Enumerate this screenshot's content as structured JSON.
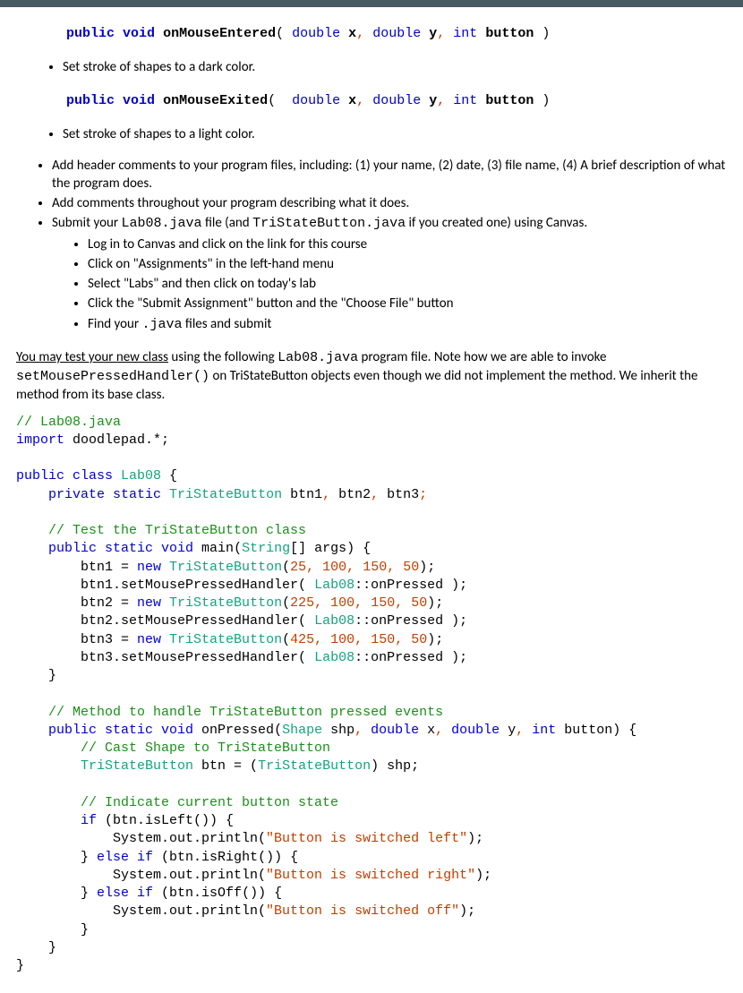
{
  "sig1": {
    "kw1": "public",
    "kw2": "void",
    "method": "onMouseEntered",
    "open": "(",
    "t1": "double",
    "p1": "x",
    "c1": ",",
    "t2": "double",
    "p2": "y",
    "c2": ",",
    "t3": "int",
    "p3": "button",
    "close": ")"
  },
  "sig1_note": "Set stroke of shapes to a dark color.",
  "sig2": {
    "kw1": "public",
    "kw2": "void",
    "method": "onMouseExited",
    "open": "(",
    "t1": "double",
    "p1": "x",
    "c1": ",",
    "t2": "double",
    "p2": "y",
    "c2": ",",
    "t3": "int",
    "p3": "button",
    "close": ")"
  },
  "sig2_note": "Set stroke of shapes to a light color.",
  "bullets": {
    "b1": "Add header comments to your program files, including: (1) your name, (2) date, (3) file name, (4) A brief description of what the program does.",
    "b2": "Add comments throughout your program describing what it does.",
    "b3_pre": "Submit your ",
    "b3_code1": "Lab08.java",
    "b3_mid": " file (and ",
    "b3_code2": "TriStateButton.java",
    "b3_post": " if you created one) using Canvas.",
    "sub1": "Log in to Canvas and click on the link for this course",
    "sub2": "Click on \"Assignments\" in the left-hand menu",
    "sub3": "Select \"Labs\" and then click on today's lab",
    "sub4": "Click the \"Submit Assignment\" button and the \"Choose File\" button",
    "sub5_pre": "Find your ",
    "sub5_code": ".java",
    "sub5_post": " files and submit"
  },
  "para": {
    "u": "You may test your new class",
    "t1": " using the following ",
    "c1": "Lab08.java",
    "t2": " program file. Note how we are able to invoke ",
    "c2": "setMousePressedHandler()",
    "t3": " on TriStateButton objects even though we did not implement the method. We inherit the method from its base class."
  },
  "code": {
    "l01a": "// Lab08.java",
    "l02a": "import",
    "l02b": " doodlepad.*;",
    "l04a": "public",
    "l04b": " class",
    "l04c": " Lab08",
    "l04d": " {",
    "l05a": "    private",
    "l05b": " static",
    "l05c": " TriStateButton",
    "l05d": " btn1",
    "l05p1": ",",
    "l05e": " btn2",
    "l05p2": ",",
    "l05f": " btn3",
    "l05p3": ";",
    "l07a": "    // Test the TriStateButton class",
    "l08a": "    public",
    "l08b": " static",
    "l08c": " void",
    "l08d": " main",
    "l08e": "(",
    "l08f": "String",
    "l08g": "[] args) {",
    "l09a": "        btn1 = ",
    "l09b": "new",
    "l09c": " TriStateButton",
    "l09d": "(",
    "l09n1": "25",
    "l09c1": ",",
    "l09s1": " ",
    "l09n2": "100",
    "l09c2": ",",
    "l09s2": " ",
    "l09n3": "150",
    "l09c3": ",",
    "l09s3": " ",
    "l09n4": "50",
    "l09e": ");",
    "l10a": "        btn1.setMousePressedHandler( ",
    "l10b": "Lab08",
    "l10c": "::onPressed );",
    "l11a": "        btn2 = ",
    "l11b": "new",
    "l11c": " TriStateButton",
    "l11d": "(",
    "l11n1": "225",
    "l11c1": ",",
    "l11s1": " ",
    "l11n2": "100",
    "l11c2": ",",
    "l11s2": " ",
    "l11n3": "150",
    "l11c3": ",",
    "l11s3": " ",
    "l11n4": "50",
    "l11e": ");",
    "l12a": "        btn2.setMousePressedHandler( ",
    "l12b": "Lab08",
    "l12c": "::onPressed );",
    "l13a": "        btn3 = ",
    "l13b": "new",
    "l13c": " TriStateButton",
    "l13d": "(",
    "l13n1": "425",
    "l13c1": ",",
    "l13s1": " ",
    "l13n2": "100",
    "l13c2": ",",
    "l13s2": " ",
    "l13n3": "150",
    "l13c3": ",",
    "l13s3": " ",
    "l13n4": "50",
    "l13e": ");",
    "l14a": "        btn3.setMousePressedHandler( ",
    "l14b": "Lab08",
    "l14c": "::onPressed );",
    "l15a": "    }",
    "l17a": "    // Method to handle TriStateButton pressed events",
    "l18a": "    public",
    "l18b": " static",
    "l18c": " void",
    "l18d": " onPressed",
    "l18e": "(",
    "l18f": "Shape",
    "l18g": " shp",
    "l18p1": ",",
    "l18h": " double",
    "l18i": " x",
    "l18p2": ",",
    "l18j": " double",
    "l18k": " y",
    "l18p3": ",",
    "l18l": " int",
    "l18m": " button) {",
    "l19a": "        // Cast Shape to TriStateButton",
    "l20a": "        TriStateButton",
    "l20b": " btn = (",
    "l20c": "TriStateButton",
    "l20d": ") shp;",
    "l22a": "        // Indicate current button state",
    "l23a": "        if",
    "l23b": " (btn.isLeft()) {",
    "l24a": "            System.out.println(",
    "l24b": "\"Button is switched left\"",
    "l24c": ");",
    "l25a": "        } ",
    "l25b": "else",
    "l25c": " if",
    "l25d": " (btn.isRight()) {",
    "l26a": "            System.out.println(",
    "l26b": "\"Button is switched right\"",
    "l26c": ");",
    "l27a": "        } ",
    "l27b": "else",
    "l27c": " if",
    "l27d": " (btn.isOff()) {",
    "l28a": "            System.out.println(",
    "l28b": "\"Button is switched off\"",
    "l28c": ");",
    "l29a": "        }",
    "l30a": "    }",
    "l31a": "}"
  }
}
